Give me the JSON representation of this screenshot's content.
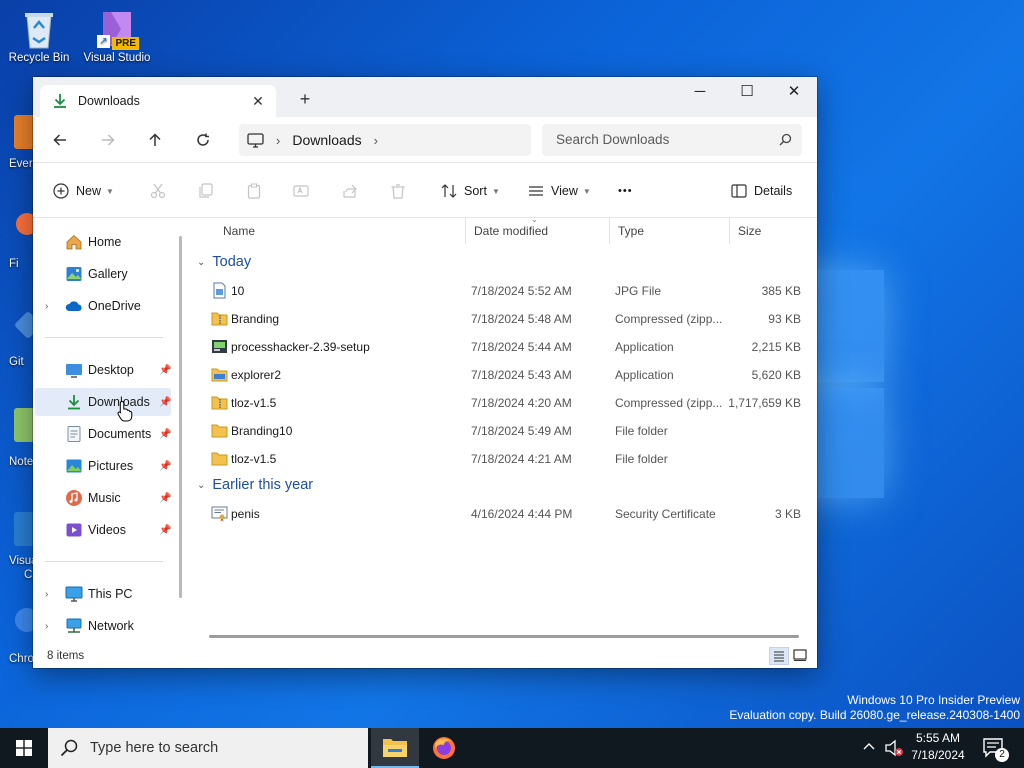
{
  "desktop": {
    "icons": [
      {
        "label": "Recycle Bin"
      },
      {
        "label": "Visual Studio"
      }
    ],
    "badge": "PRE",
    "edge_labels": [
      "Ever",
      "Fi",
      "Git",
      "Note",
      "Visua",
      "C",
      "Chro"
    ],
    "watermark_line1": "Windows 10 Pro Insider Preview",
    "watermark_line2": "Evaluation copy. Build 26080.ge_release.240308-1400"
  },
  "window": {
    "tab_title": "Downloads",
    "tab_close": "✕",
    "new_tab": "+",
    "minimize": "─",
    "maximize": "☐",
    "close": "✕",
    "breadcrumb": [
      "Downloads"
    ],
    "search_placeholder": "Search Downloads",
    "toolbar": {
      "new_label": "New",
      "sort_label": "Sort",
      "view_label": "View",
      "more_label": "•••",
      "details_label": "Details"
    }
  },
  "nav": {
    "items": [
      {
        "label": "Home"
      },
      {
        "label": "Gallery"
      },
      {
        "label": "OneDrive"
      },
      {
        "label": "Desktop"
      },
      {
        "label": "Downloads"
      },
      {
        "label": "Documents"
      },
      {
        "label": "Pictures"
      },
      {
        "label": "Music"
      },
      {
        "label": "Videos"
      },
      {
        "label": "This PC"
      },
      {
        "label": "Network"
      }
    ]
  },
  "columns": {
    "name": "Name",
    "date": "Date modified",
    "type": "Type",
    "size": "Size"
  },
  "groups": [
    {
      "title": "Today",
      "files": [
        {
          "name": "10",
          "date": "7/18/2024 5:52 AM",
          "type": "JPG File",
          "size": "385 KB",
          "icon": "image-file-icon"
        },
        {
          "name": "Branding",
          "date": "7/18/2024 5:48 AM",
          "type": "Compressed (zipp...",
          "size": "93 KB",
          "icon": "zip-folder-icon"
        },
        {
          "name": "processhacker-2.39-setup",
          "date": "7/18/2024 5:44 AM",
          "type": "Application",
          "size": "2,215 KB",
          "icon": "setup-app-icon"
        },
        {
          "name": "explorer2",
          "date": "7/18/2024 5:43 AM",
          "type": "Application",
          "size": "5,620 KB",
          "icon": "explorer-app-icon"
        },
        {
          "name": "tloz-v1.5",
          "date": "7/18/2024 4:20 AM",
          "type": "Compressed (zipp...",
          "size": "1,717,659 KB",
          "icon": "zip-folder-icon"
        },
        {
          "name": "Branding10",
          "date": "7/18/2024 5:49 AM",
          "type": "File folder",
          "size": "",
          "icon": "folder-icon"
        },
        {
          "name": "tloz-v1.5",
          "date": "7/18/2024 4:21 AM",
          "type": "File folder",
          "size": "",
          "icon": "folder-icon"
        }
      ]
    },
    {
      "title": "Earlier this year",
      "files": [
        {
          "name": "penis",
          "date": "4/16/2024 4:44 PM",
          "type": "Security Certificate",
          "size": "3 KB",
          "icon": "certificate-icon"
        }
      ]
    }
  ],
  "status": {
    "item_count": "8 items"
  },
  "taskbar": {
    "search_placeholder": "Type here to search",
    "time": "5:55 AM",
    "date": "7/18/2024",
    "notification_count": "2"
  },
  "colors": {
    "accent": "#0067c0",
    "selection": "#e2ebf7",
    "group_heading": "#1f4fa0",
    "folder": "#f2c14e"
  }
}
